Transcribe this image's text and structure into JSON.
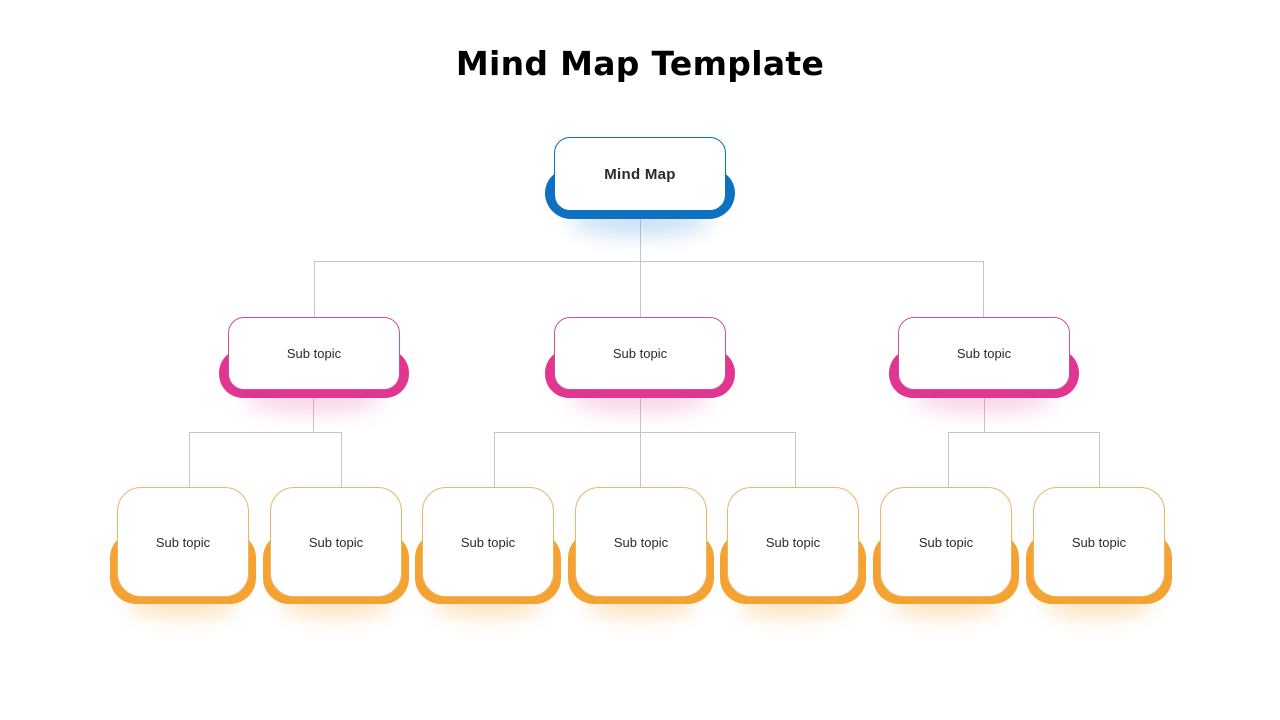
{
  "title": "Mind Map Template",
  "colors": {
    "root": "#0d70c0",
    "level1": "#e03590",
    "level2": "#f4a332",
    "connector": "#c4c4c4"
  },
  "root": {
    "label": "Mind Map"
  },
  "branches": [
    {
      "label": "Sub topic",
      "children": [
        {
          "label": "Sub topic"
        },
        {
          "label": "Sub topic"
        }
      ]
    },
    {
      "label": "Sub topic",
      "children": [
        {
          "label": "Sub topic"
        },
        {
          "label": "Sub topic"
        },
        {
          "label": "Sub topic"
        }
      ]
    },
    {
      "label": "Sub topic",
      "children": [
        {
          "label": "Sub topic"
        },
        {
          "label": "Sub topic"
        }
      ]
    }
  ]
}
